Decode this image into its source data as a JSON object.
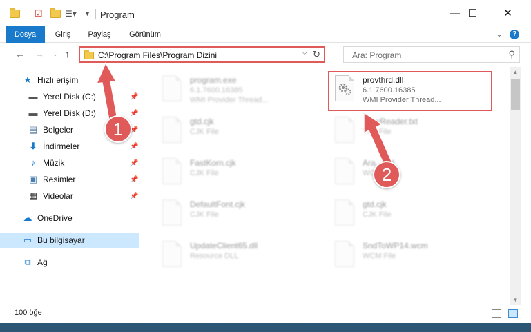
{
  "window": {
    "title": "Program"
  },
  "ribbon": {
    "tabs": [
      "Dosya",
      "Giriş",
      "Paylaş",
      "Görünüm"
    ]
  },
  "address": {
    "path": "C:\\Program Files\\Program Dizini"
  },
  "search": {
    "placeholder": "Ara: Program"
  },
  "sidebar": {
    "quick_access": "Hızlı erişim",
    "items": [
      {
        "label": "Yerel Disk (C:)",
        "icon": "drive-icon",
        "pinned": true
      },
      {
        "label": "Yerel Disk (D:)",
        "icon": "drive-icon",
        "pinned": true
      },
      {
        "label": "Belgeler",
        "icon": "documents-icon",
        "pinned": true
      },
      {
        "label": "İndirmeler",
        "icon": "download-icon",
        "pinned": true
      },
      {
        "label": "Müzik",
        "icon": "music-icon",
        "pinned": true
      },
      {
        "label": "Resimler",
        "icon": "pictures-icon",
        "pinned": true
      },
      {
        "label": "Videolar",
        "icon": "video-icon",
        "pinned": true
      }
    ],
    "onedrive": "OneDrive",
    "this_pc": "Bu bilgisayar",
    "network": "Ağ"
  },
  "files": [
    {
      "name": "program.exe",
      "line2": "6.1.7600.16385",
      "line3": "WMI Provider Thread...",
      "blurred": true
    },
    {
      "name": "provthrd.dll",
      "line2": "6.1.7600.16385",
      "line3": "WMI Provider Thread...",
      "blurred": false
    },
    {
      "name": "gtd.cjk",
      "line2": "CJK File",
      "line3": "",
      "blurred": true
    },
    {
      "name": "...ftwReader.txt",
      "line2": "TXT File",
      "line3": "",
      "blurred": true
    },
    {
      "name": "FastKorn.cjk",
      "line2": "CJK File",
      "line3": "",
      "blurred": true
    },
    {
      "name": "Ara...ord",
      "line2": "WCM",
      "line3": "",
      "blurred": true
    },
    {
      "name": "DefaultFont.cjk",
      "line2": "CJK File",
      "line3": "",
      "blurred": true
    },
    {
      "name": "gtd.cjk",
      "line2": "CJK File",
      "line3": "",
      "blurred": true
    },
    {
      "name": "UpdateClient65.dll",
      "line2": "Resource DLL",
      "line3": "",
      "blurred": true
    },
    {
      "name": "SndToWP14.wcm",
      "line2": "WCM File",
      "line3": "",
      "blurred": true
    }
  ],
  "status": {
    "count": "100 öğe"
  },
  "callouts": [
    "1",
    "2"
  ],
  "colors": {
    "accent": "#1979ca",
    "highlight": "#e05a5a",
    "selected": "#cce8ff"
  }
}
